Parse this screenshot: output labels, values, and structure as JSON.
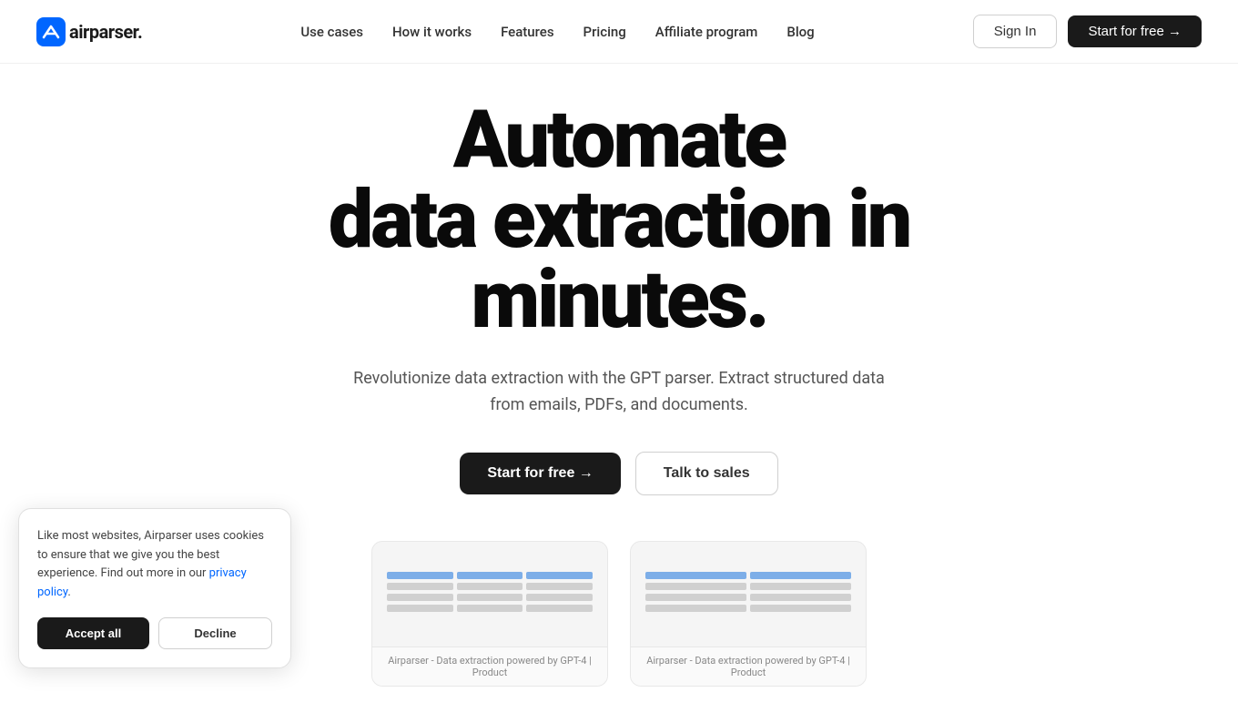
{
  "brand": {
    "name": "airparser.",
    "logo_alt": "Airparser logo"
  },
  "nav": {
    "links": [
      {
        "label": "Use cases",
        "href": "#"
      },
      {
        "label": "How it works",
        "href": "#"
      },
      {
        "label": "Features",
        "href": "#"
      },
      {
        "label": "Pricing",
        "href": "#"
      },
      {
        "label": "Affiliate program",
        "href": "#"
      },
      {
        "label": "Blog",
        "href": "#"
      }
    ],
    "sign_in": "Sign In",
    "start_free": "Start for free →"
  },
  "hero": {
    "line1": "Automate",
    "line2": "data extraction in",
    "line3": "minutes.",
    "subtext": "Revolutionize data extraction with the GPT parser. Extract structured data from emails, PDFs, and documents.",
    "cta_primary": "Start for free →",
    "cta_secondary": "Talk to sales"
  },
  "previews": [
    {
      "label": "Airparser - Data extraction powered by GPT-4 | Product"
    },
    {
      "label": "Airparser - Data extraction powered by GPT-4 | Product"
    }
  ],
  "cookie": {
    "text": "Like most websites, Airparser uses cookies to ensure that we give you the best experience. Find out more in our ",
    "link_text": "privacy policy",
    "period": ".",
    "accept": "Accept all",
    "decline": "Decline"
  }
}
